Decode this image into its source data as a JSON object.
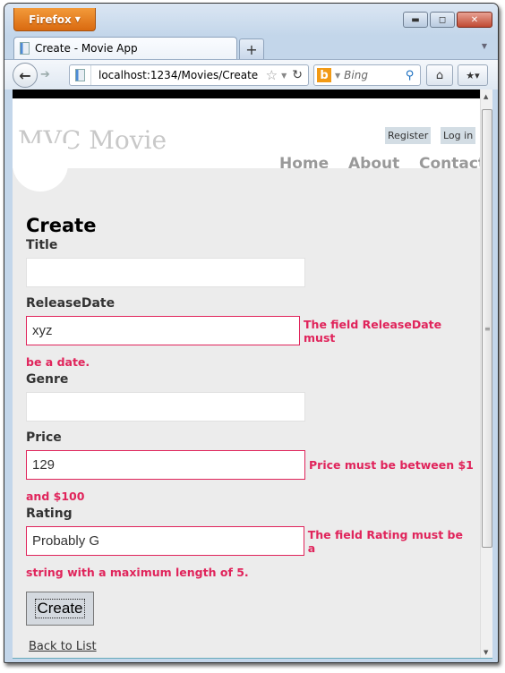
{
  "browser": {
    "app_button": "Firefox",
    "tab_title": "Create - Movie App",
    "new_tab": "+",
    "url": "localhost:1234/Movies/Create",
    "search_placeholder": "Bing",
    "window_controls": {
      "minimize": "▬",
      "maximize": "◻",
      "close": "✕"
    }
  },
  "site": {
    "title": "MVC Movie",
    "auth_links": {
      "register": "Register",
      "login": "Log in"
    },
    "menu": [
      {
        "label": "Home"
      },
      {
        "label": "About"
      },
      {
        "label": "Contact"
      }
    ]
  },
  "form": {
    "heading": "Create",
    "fields": [
      {
        "label": "Title",
        "value": "",
        "error": null
      },
      {
        "label": "ReleaseDate",
        "value": "xyz",
        "error_line1": "The field ReleaseDate must",
        "error_line2": "be a date."
      },
      {
        "label": "Genre",
        "value": "",
        "error": null
      },
      {
        "label": "Price",
        "value": "129",
        "error_line1": "Price must be between $1",
        "error_line2": "and $100"
      },
      {
        "label": "Rating",
        "value": "Probably G",
        "error_line1": "The field Rating must be a",
        "error_line2": "string with a maximum length of 5."
      }
    ],
    "submit_label": "Create",
    "back_link": "Back to List"
  },
  "colors": {
    "error": "#e0245b",
    "page_bg": "#ececec",
    "firefox_orange": "#e67e22"
  }
}
